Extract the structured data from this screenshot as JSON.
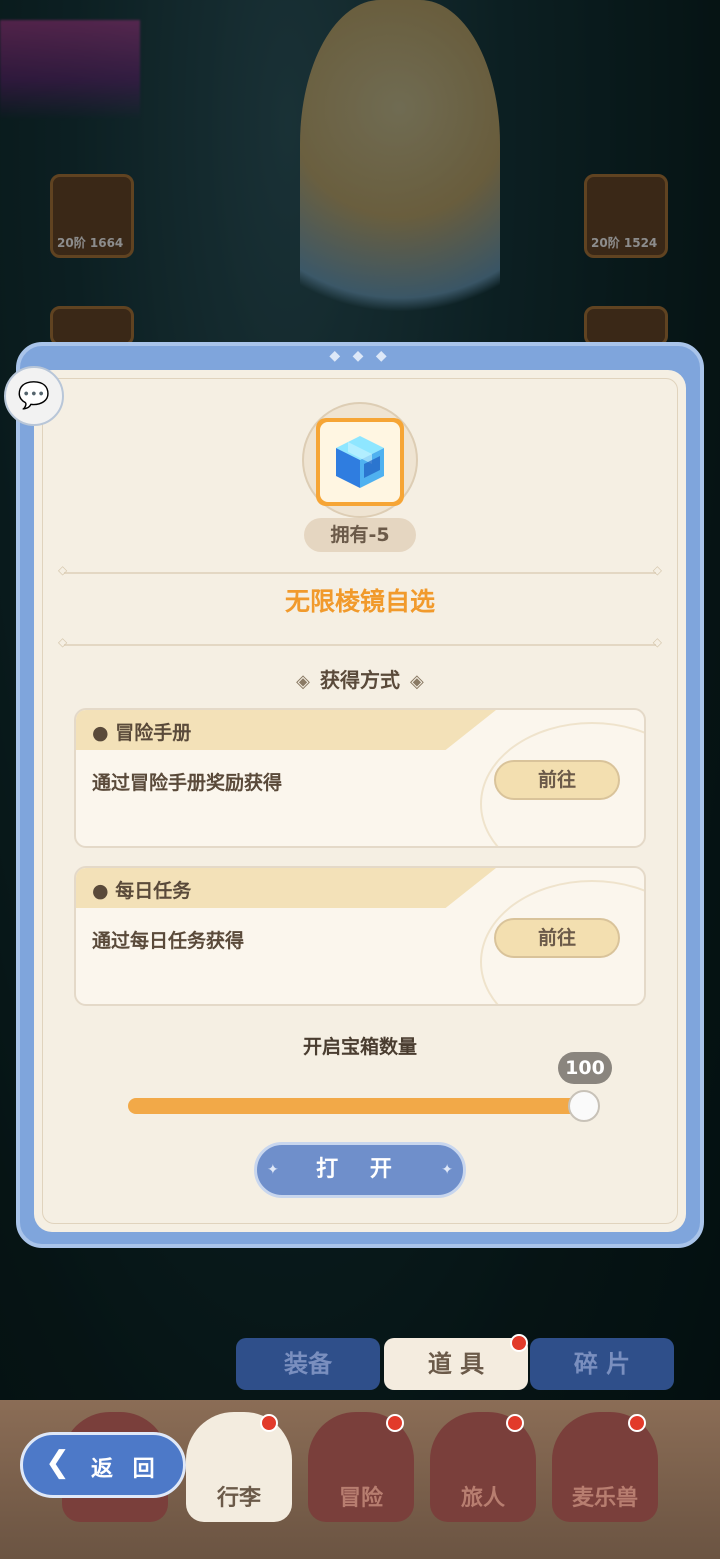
{
  "background": {
    "left_slot_1_caption": "20阶 1664",
    "right_slot_1_caption": "20阶 1524"
  },
  "chat_icon": "chat-bubbles-icon",
  "dialog": {
    "owned_label": "拥有-5",
    "item_title": "无限棱镜自选",
    "acquire_section_title": "获得方式",
    "sources": [
      {
        "name": "冒险手册",
        "description": "通过冒险手册奖励获得",
        "button": "前往"
      },
      {
        "name": "每日任务",
        "description": "通过每日任务获得",
        "button": "前往"
      }
    ],
    "quantity_label": "开启宝箱数量",
    "quantity_value": "100",
    "quantity_fill": 1.0,
    "open_button": "打 开"
  },
  "bottom_tabs": [
    {
      "label": "装备",
      "active": false
    },
    {
      "label": "道 具",
      "active": true
    },
    {
      "label": "碎 片",
      "active": false
    }
  ],
  "bottom_nav": [
    {
      "label": "行李",
      "active": true
    },
    {
      "label": "冒险",
      "active": false
    },
    {
      "label": "旅人",
      "active": false
    },
    {
      "label": "麦乐兽",
      "active": false
    }
  ],
  "back_button": "返 回",
  "colors": {
    "accent_orange": "#f19a2c",
    "dialog_blue": "#7fa5dc",
    "panel_cream": "#f5efe3",
    "button_blue": "#6f8fcb"
  }
}
